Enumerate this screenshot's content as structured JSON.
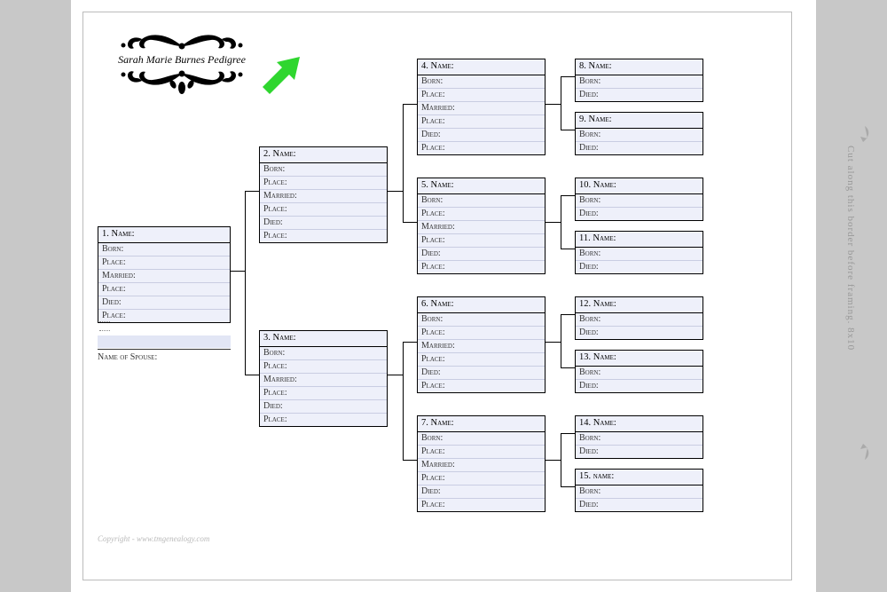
{
  "title": "Sarah Marie Burnes Pedigree",
  "spouse_label": "Name of Spouse:",
  "copyright": "Copyright - www.tmgenealogy.com",
  "side_text": "Cut along this border before framing. 8x10",
  "labels": {
    "born": "Born:",
    "place": "Place:",
    "married": "Married:",
    "died": "Died:",
    "name": "Name:"
  },
  "boxes": {
    "b1": {
      "num": "1.",
      "head": "Name:",
      "full": true
    },
    "b2": {
      "num": "2.",
      "head": "Name:",
      "full": true
    },
    "b3": {
      "num": "3.",
      "head": "Name:",
      "full": true
    },
    "b4": {
      "num": "4.",
      "head": "Name:",
      "full": true
    },
    "b5": {
      "num": "5.",
      "head": "Name:",
      "full": true
    },
    "b6": {
      "num": "6.",
      "head": "Name:",
      "full": true
    },
    "b7": {
      "num": "7.",
      "head": "Name:",
      "full": true
    },
    "b8": {
      "num": "8.",
      "head": "Name:",
      "full": false
    },
    "b9": {
      "num": "9.",
      "head": "Name:",
      "full": false
    },
    "b10": {
      "num": "10.",
      "head": "Name:",
      "full": false
    },
    "b11": {
      "num": "11.",
      "head": "Name:",
      "full": false
    },
    "b12": {
      "num": "12.",
      "head": "Name:",
      "full": false
    },
    "b13": {
      "num": "13.",
      "head": "Name:",
      "full": false
    },
    "b14": {
      "num": "14.",
      "head": "Name:",
      "full": false
    },
    "b15": {
      "num": "15.",
      "head": "name:",
      "full": false
    }
  }
}
